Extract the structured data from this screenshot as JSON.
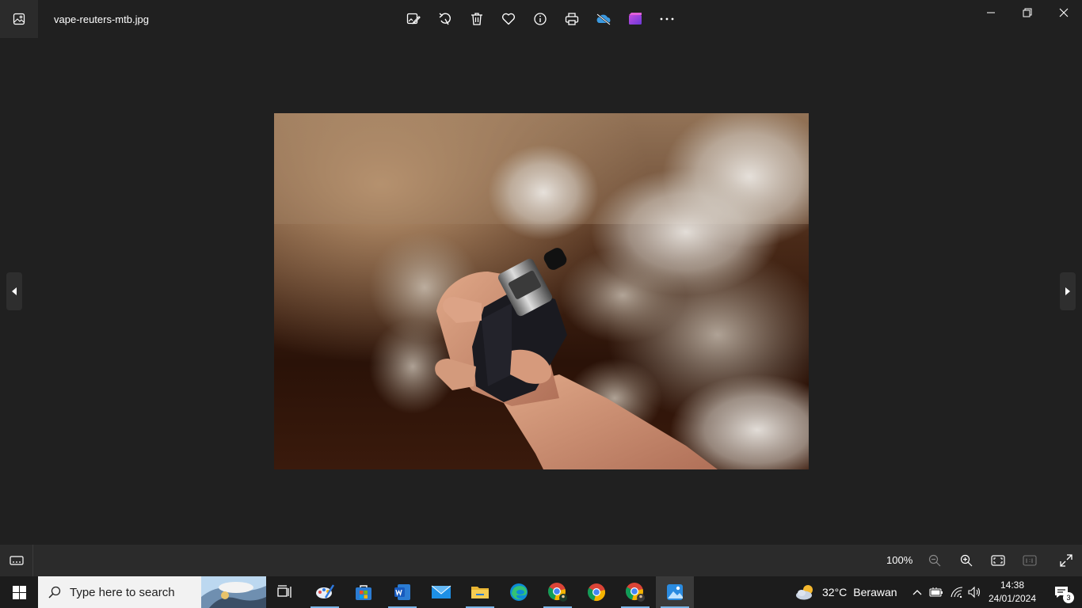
{
  "window": {
    "file_name": "vape-reuters-mtb.jpg",
    "controls": [
      "minimize",
      "restore",
      "close"
    ]
  },
  "toolbar": {
    "items": [
      {
        "icon": "edit-image-icon"
      },
      {
        "icon": "rotate-icon"
      },
      {
        "icon": "delete-icon"
      },
      {
        "icon": "favorite-heart-icon"
      },
      {
        "icon": "info-icon"
      },
      {
        "icon": "print-icon"
      },
      {
        "icon": "onedrive-icon"
      },
      {
        "icon": "clipchamp-icon"
      },
      {
        "icon": "more-icon"
      }
    ]
  },
  "bottom_bar": {
    "zoom": "100%"
  },
  "taskbar": {
    "search_placeholder": "Type here to search",
    "weather_temp": "32°C",
    "weather_desc": "Berawan",
    "time": "14:38",
    "date": "24/01/2024",
    "notification_count": "3"
  },
  "colors": {
    "background": "#202020",
    "bar": "#2b2b2b",
    "taskbar": "#1c1c1c",
    "accent": "#7ab5e6"
  }
}
